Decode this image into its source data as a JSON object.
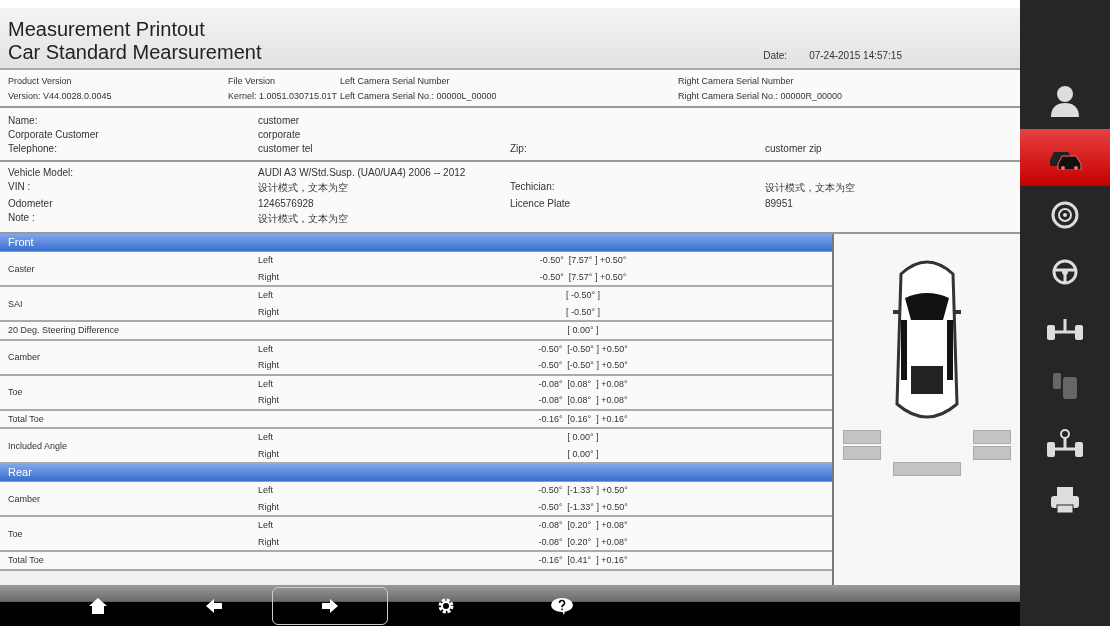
{
  "header": {
    "title": "Measurement Printout",
    "subtitle": "Car Standard Mearsurement",
    "date_label": "Date:",
    "date_value": "07-24-2015 14:57:15"
  },
  "versions": [
    {
      "label": "Product Version",
      "value": "Version: V44.0028.0.0045"
    },
    {
      "label": "File Version",
      "value": "Kernel: 1.0051.030715.01T"
    },
    {
      "label": "Left Camera Serial Number",
      "value": "Left Camera Serial No.: 00000L_00000"
    },
    {
      "label": "Right Camera Serial Number",
      "value": "Right Camera Serial No.: 00000R_00000"
    }
  ],
  "customer": [
    [
      "Name:",
      "customer"
    ],
    [
      "Corporate Customer",
      "corporate"
    ],
    [
      "Telephone:",
      "customer tel",
      "Zip:",
      "customer zip"
    ]
  ],
  "vehicle": [
    [
      "Vehicle Model:",
      "AUDI  A3 W/Std.Susp. (UA0/UA4)  2006 -- 2012"
    ],
    [
      "VIN :",
      "设计模式，文本为空",
      "Techician:",
      "设计模式，文本为空"
    ],
    [
      "Odometer",
      "1246576928",
      "Licence Plate",
      "89951"
    ],
    [
      "Note :",
      "设计模式，文本为空"
    ]
  ],
  "sections": [
    {
      "title": "Front",
      "rows": [
        {
          "name": "Caster",
          "lines": [
            {
              "side": "Left",
              "value": "-0.50°  [7.57° ] +0.50°"
            },
            {
              "side": "Right",
              "value": "-0.50°  [7.57° ] +0.50°"
            }
          ]
        },
        {
          "name": "SAI",
          "lines": [
            {
              "side": "Left",
              "value": "[ -0.50° ]"
            },
            {
              "side": "Right",
              "value": "[ -0.50° ]"
            }
          ]
        },
        {
          "name": "20 Deg. Steering Difference",
          "lines": [
            {
              "value": "[ 0.00° ]"
            }
          ]
        },
        {
          "name": "Camber",
          "lines": [
            {
              "side": "Left",
              "value": "-0.50°  [-0.50° ] +0.50°"
            },
            {
              "side": "Right",
              "value": "-0.50°  [-0.50° ] +0.50°"
            }
          ]
        },
        {
          "name": "Toe",
          "lines": [
            {
              "side": "Left",
              "value": "-0.08°  [0.08°  ] +0.08°"
            },
            {
              "side": "Right",
              "value": "-0.08°  [0.08°  ] +0.08°"
            }
          ]
        },
        {
          "name": "Total Toe",
          "lines": [
            {
              "value": "-0.16°  [0.16°  ] +0.16°"
            }
          ]
        },
        {
          "name": "Included Angle",
          "lines": [
            {
              "side": "Left",
              "value": "[ 0.00° ]"
            },
            {
              "side": "Right",
              "value": "[ 0.00° ]"
            }
          ]
        }
      ]
    },
    {
      "title": "Rear",
      "rows": [
        {
          "name": "Camber",
          "lines": [
            {
              "side": "Left",
              "value": "-0.50°  [-1.33° ] +0.50°"
            },
            {
              "side": "Right",
              "value": "-0.50°  [-1.33° ] +0.50°"
            }
          ]
        },
        {
          "name": "Toe",
          "lines": [
            {
              "side": "Left",
              "value": "-0.08°  [0.20°  ] +0.08°"
            },
            {
              "side": "Right",
              "value": "-0.08°  [0.20°  ] +0.08°"
            }
          ]
        },
        {
          "name": "Total Toe",
          "lines": [
            {
              "value": "-0.16°  [0.41°  ] +0.16°"
            }
          ]
        }
      ]
    }
  ],
  "sidebar": {
    "items": [
      {
        "selected": false,
        "disabled": false
      },
      {
        "selected": true,
        "disabled": false
      },
      {
        "selected": false,
        "disabled": false
      },
      {
        "selected": false,
        "disabled": false
      },
      {
        "selected": false,
        "disabled": false
      },
      {
        "selected": false,
        "disabled": true
      },
      {
        "selected": false,
        "disabled": false
      },
      {
        "selected": false,
        "disabled": false
      }
    ]
  },
  "toolbar": {
    "buttons": [
      {
        "selected": false
      },
      {
        "selected": false
      },
      {
        "selected": true
      },
      {
        "selected": false
      },
      {
        "selected": false
      }
    ]
  }
}
